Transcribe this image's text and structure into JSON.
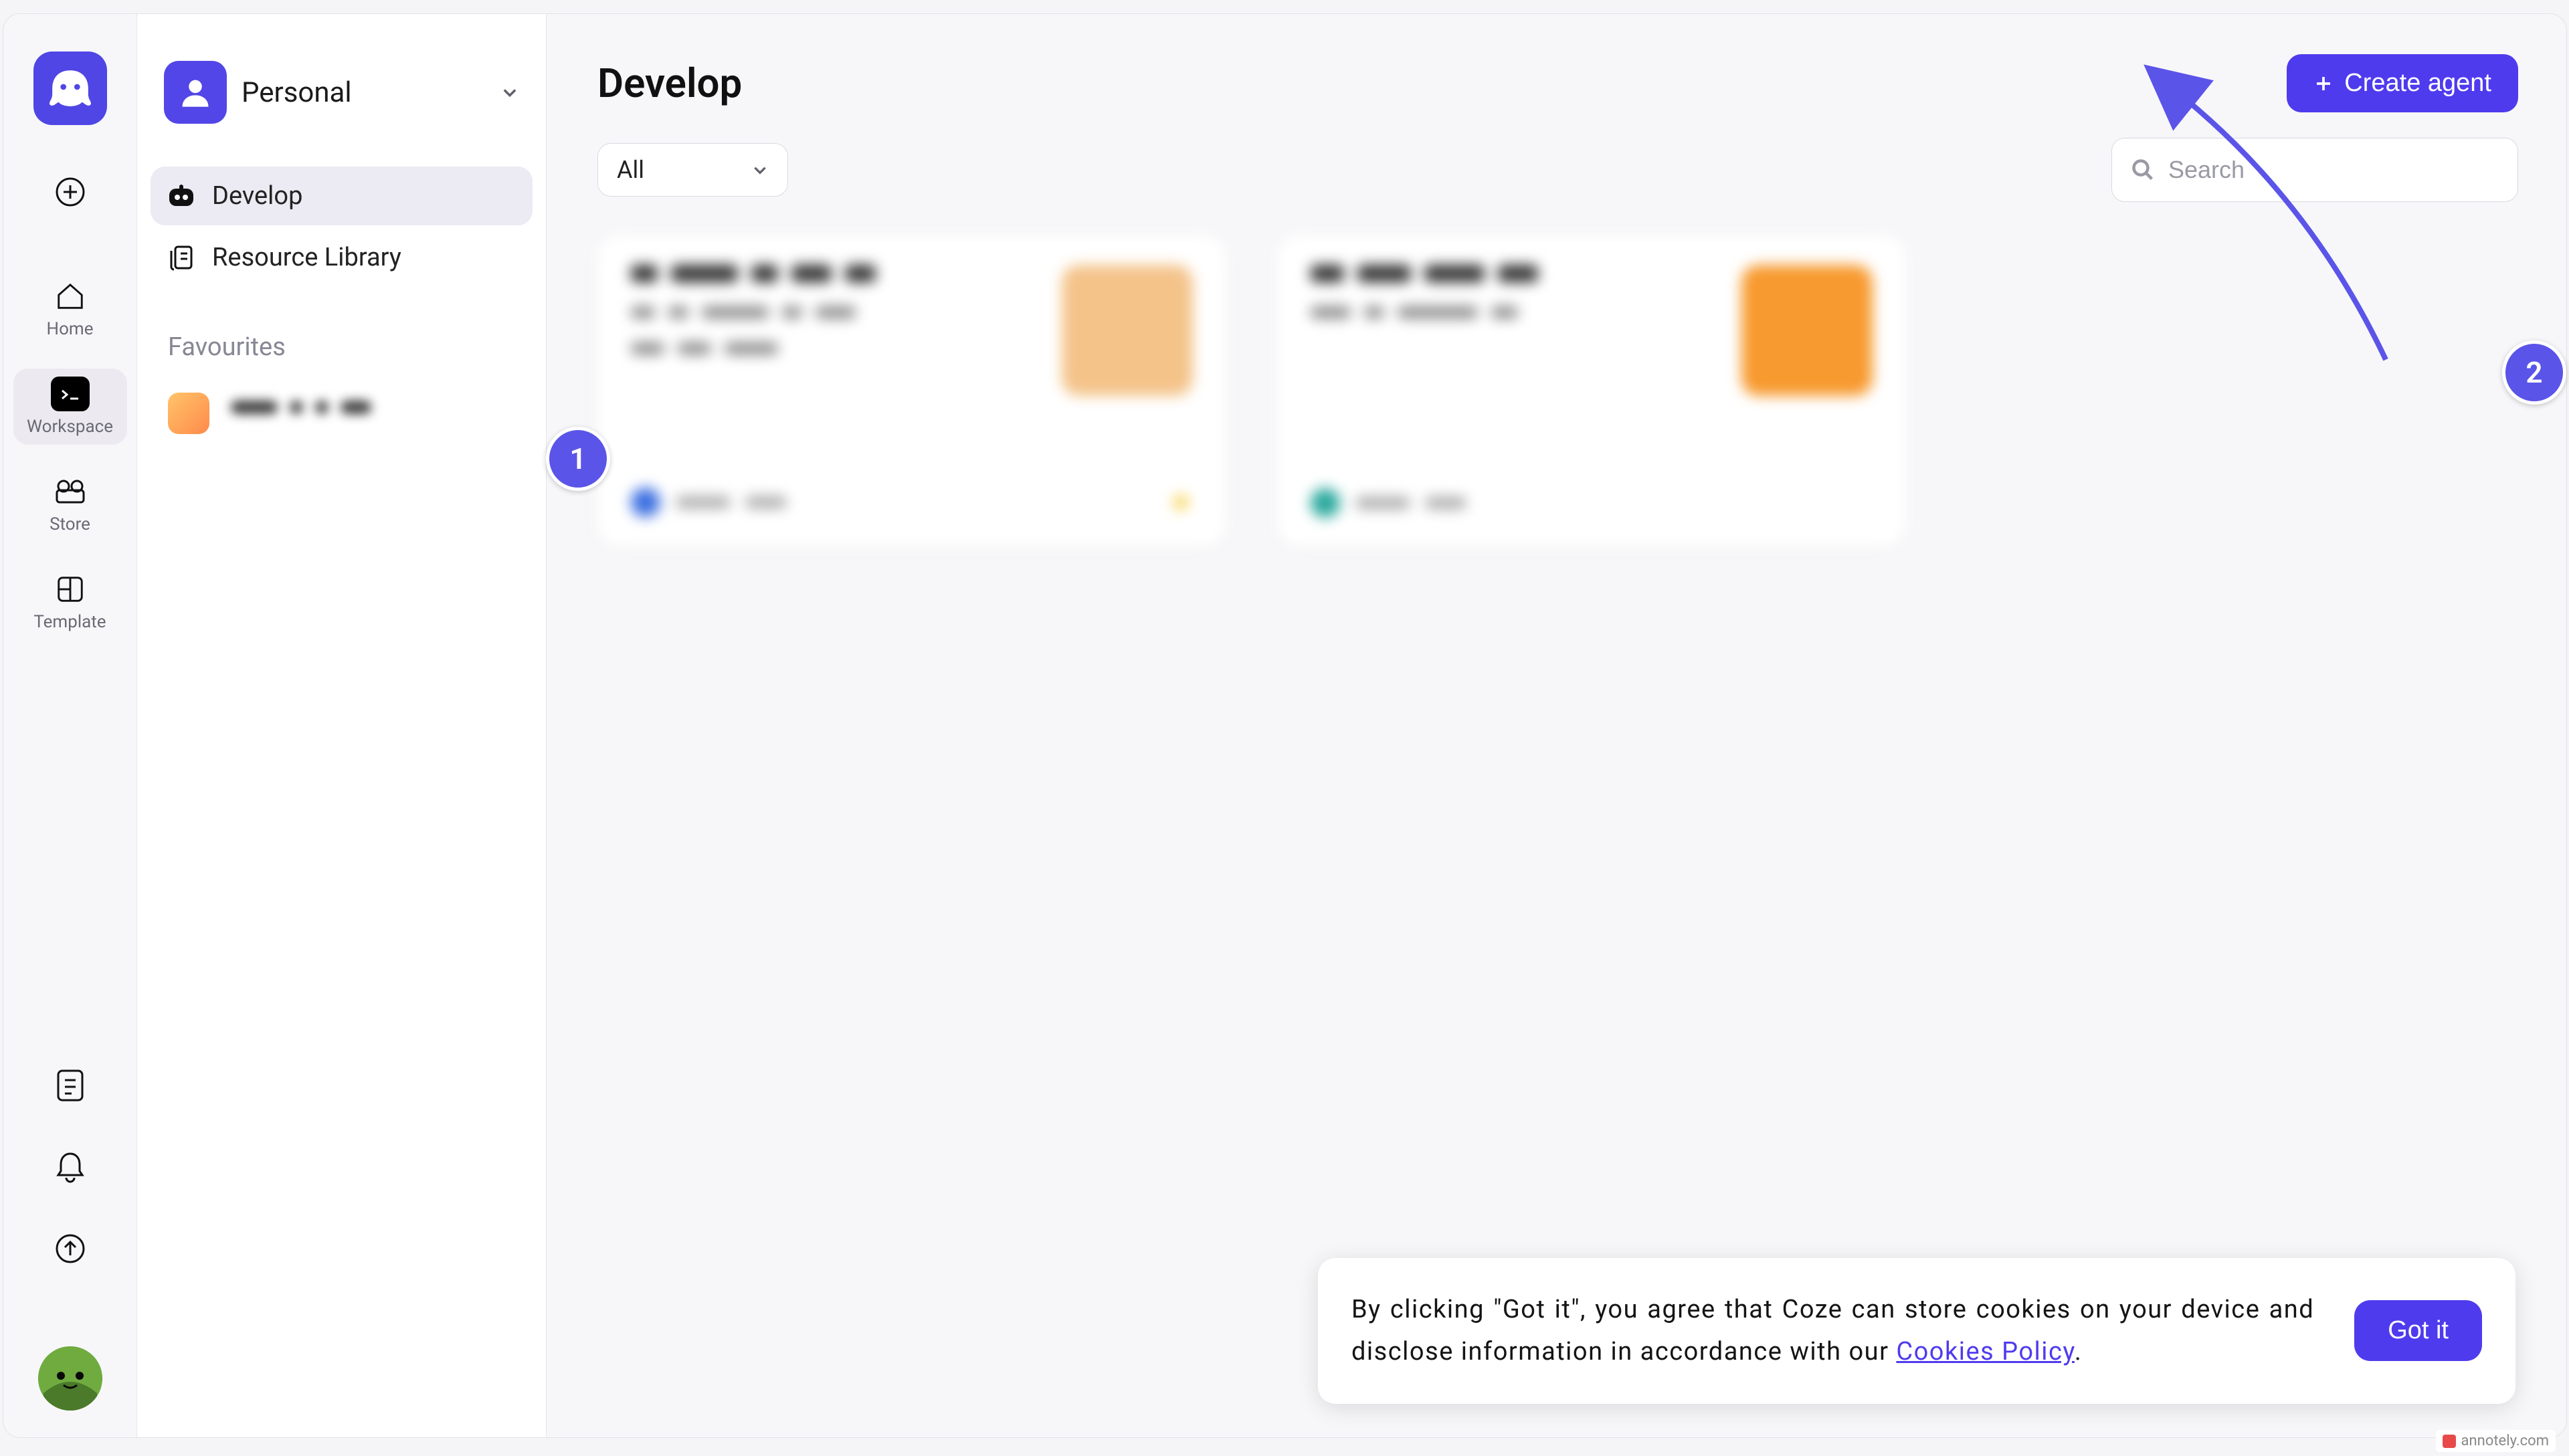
{
  "brand": {
    "name": "coze"
  },
  "rail": {
    "add_label": "+",
    "items": [
      {
        "id": "home",
        "label": "Home"
      },
      {
        "id": "workspace",
        "label": "Workspace"
      },
      {
        "id": "store",
        "label": "Store"
      },
      {
        "id": "template",
        "label": "Template"
      }
    ],
    "active": "workspace"
  },
  "sidebar": {
    "workspace_switch": {
      "label": "Personal"
    },
    "items": [
      {
        "id": "develop",
        "label": "Develop",
        "active": true
      },
      {
        "id": "resource_library",
        "label": "Resource Library",
        "active": false
      }
    ],
    "favourites_title": "Favourites"
  },
  "main": {
    "page_title": "Develop",
    "create_label": "Create agent",
    "filter": {
      "selected": "All"
    },
    "search": {
      "placeholder": "Search",
      "value": ""
    }
  },
  "cookie_banner": {
    "text_prefix": "By clicking \"Got it\", you agree that Coze can store cookies on your device and disclose information in accordance with our ",
    "link_text": "Cookies Policy",
    "text_suffix": ".",
    "button": "Got it"
  },
  "annotations": {
    "one": "1",
    "two": "2"
  },
  "attribution": "annotely.com"
}
